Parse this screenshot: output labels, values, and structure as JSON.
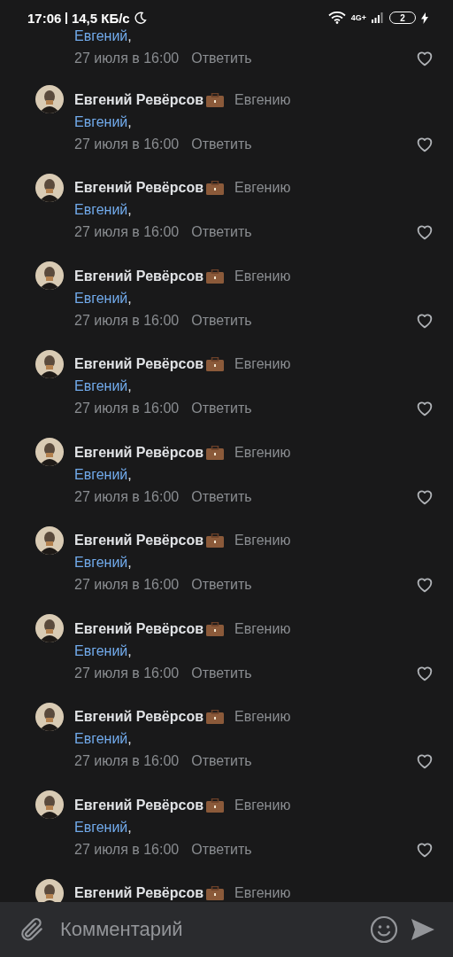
{
  "status_bar": {
    "time": "17:06",
    "speed": "14,5 КБ/с",
    "network": "4G+",
    "battery": "2",
    "charging": true
  },
  "top_fragment": {
    "mention": "Евгений",
    "text": ",",
    "date": "27 июля в 16:00",
    "reply": "Ответить"
  },
  "comments": [
    {
      "author": "Евгений Ревёрсов",
      "reply_to": "Евгению",
      "mention": "Евгений",
      "text": ",",
      "date": "27 июля в 16:00",
      "reply": "Ответить"
    },
    {
      "author": "Евгений Ревёрсов",
      "reply_to": "Евгению",
      "mention": "Евгений",
      "text": ",",
      "date": "27 июля в 16:00",
      "reply": "Ответить"
    },
    {
      "author": "Евгений Ревёрсов",
      "reply_to": "Евгению",
      "mention": "Евгений",
      "text": ",",
      "date": "27 июля в 16:00",
      "reply": "Ответить"
    },
    {
      "author": "Евгений Ревёрсов",
      "reply_to": "Евгению",
      "mention": "Евгений",
      "text": ",",
      "date": "27 июля в 16:00",
      "reply": "Ответить"
    },
    {
      "author": "Евгений Ревёрсов",
      "reply_to": "Евгению",
      "mention": "Евгений",
      "text": ",",
      "date": "27 июля в 16:00",
      "reply": "Ответить"
    },
    {
      "author": "Евгений Ревёрсов",
      "reply_to": "Евгению",
      "mention": "Евгений",
      "text": ",",
      "date": "27 июля в 16:00",
      "reply": "Ответить"
    },
    {
      "author": "Евгений Ревёрсов",
      "reply_to": "Евгению",
      "mention": "Евгений",
      "text": ",",
      "date": "27 июля в 16:00",
      "reply": "Ответить"
    },
    {
      "author": "Евгений Ревёрсов",
      "reply_to": "Евгению",
      "mention": "Евгений",
      "text": ",",
      "date": "27 июля в 16:00",
      "reply": "Ответить"
    },
    {
      "author": "Евгений Ревёрсов",
      "reply_to": "Евгению",
      "mention": "Евгений",
      "text": ",",
      "date": "27 июля в 16:00",
      "reply": "Ответить"
    },
    {
      "author": "Евгений Ревёрсов",
      "reply_to": "Евгению"
    }
  ],
  "composer": {
    "placeholder": "Комментарий"
  }
}
